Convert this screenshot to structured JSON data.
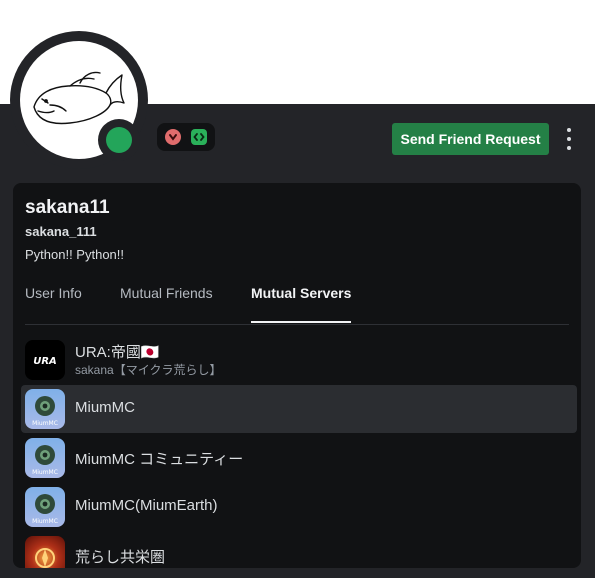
{
  "profile": {
    "display_name": "sakana11",
    "username": "sakana_111",
    "bio": "Python!! Python!!",
    "status": "online",
    "status_color": "#23a55a",
    "avatar_icon": "fish-drawing-icon",
    "badges": [
      "nitro-badge-icon",
      "developer-badge-icon"
    ]
  },
  "actions": {
    "send_friend_request": "Send Friend Request",
    "more_icon": "more-vertical-icon"
  },
  "tabs": [
    {
      "label": "User Info",
      "active": false
    },
    {
      "label": "Mutual Friends",
      "active": false
    },
    {
      "label": "Mutual Servers",
      "active": true
    }
  ],
  "servers": [
    {
      "name": "URA:帝國🇯🇵",
      "nickname": "sakana【マイクラ荒らし】",
      "icon": "ura-logo-icon",
      "icon_text": "URA"
    },
    {
      "name": "MiumMC",
      "nickname": null,
      "icon": "miummc-icon",
      "icon_text": "MiumMC",
      "hovered": true
    },
    {
      "name": "MiumMC コミュニティー",
      "nickname": null,
      "icon": "miummc-icon",
      "icon_text": "MiumMC"
    },
    {
      "name": "MiumMC(MiumEarth)",
      "nickname": null,
      "icon": "miummc-icon",
      "icon_text": "MiumMC"
    },
    {
      "name": "荒らし共栄圏",
      "nickname": null,
      "icon": "arashi-emblem-icon"
    }
  ],
  "colors": {
    "panel": "#232428",
    "card": "#111214",
    "accent_green": "#248046"
  }
}
